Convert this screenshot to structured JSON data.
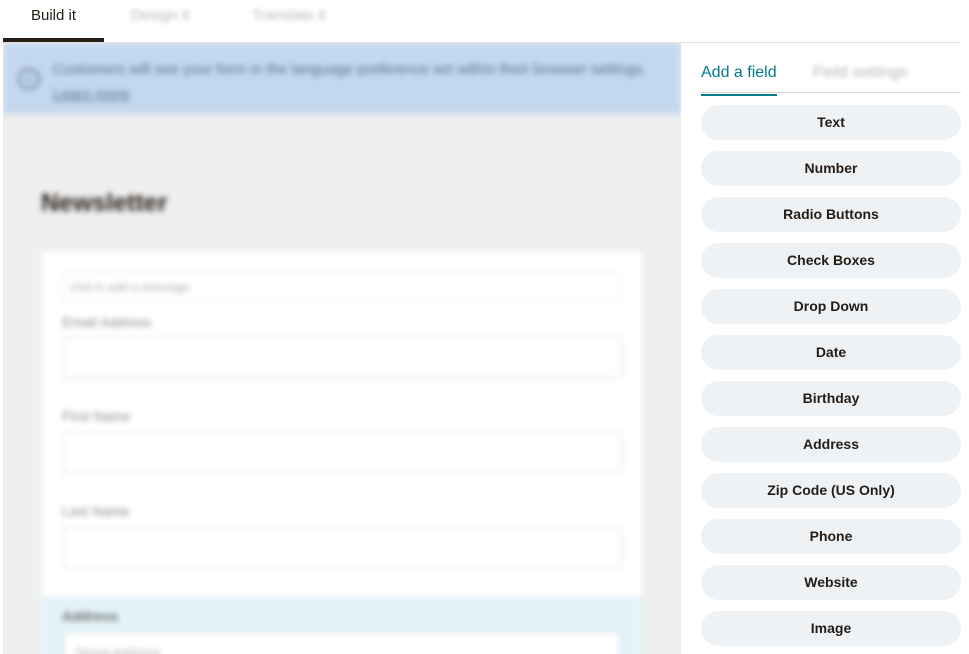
{
  "top_tabs": [
    {
      "label": "Build it",
      "active": true
    },
    {
      "label": "Design it",
      "active": false
    },
    {
      "label": "Translate it",
      "active": false
    }
  ],
  "banner": {
    "text": "Customers will see your form in the language preference set within their browser settings.",
    "link": "Learn more"
  },
  "form": {
    "title": "Newsletter",
    "message_placeholder": "Unit to add a message",
    "fields": [
      {
        "label": "Email Address"
      },
      {
        "label": "First Name"
      },
      {
        "label": "Last Name"
      }
    ],
    "address": {
      "label": "Address",
      "street_placeholder": "Street Address"
    }
  },
  "panel": {
    "tabs": [
      {
        "label": "Add a field",
        "active": true
      },
      {
        "label": "Field settings",
        "active": false
      }
    ],
    "field_types": [
      "Text",
      "Number",
      "Radio Buttons",
      "Check Boxes",
      "Drop Down",
      "Date",
      "Birthday",
      "Address",
      "Zip Code (US Only)",
      "Phone",
      "Website",
      "Image"
    ]
  },
  "colors": {
    "accent": "#007c89",
    "banner_bg": "#c3d8ef",
    "button_bg": "#eff2f5",
    "text": "#241c15"
  }
}
